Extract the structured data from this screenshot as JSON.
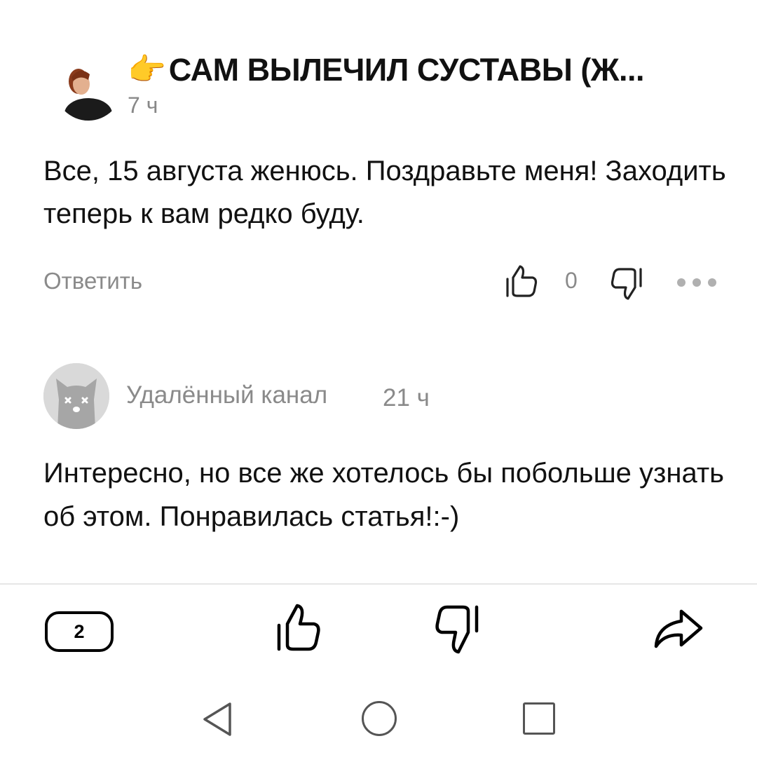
{
  "comments": [
    {
      "author": "САМ ВЫЛЕЧИЛ СУСТАВЫ (Ж...",
      "author_emoji": "👉",
      "time": "7 ч",
      "text": "Все, 15 августа женюсь. Поздравьте меня! Заходить теперь к вам редко буду.",
      "reply_label": "Ответить",
      "likes": "0"
    },
    {
      "author": "Удалённый канал",
      "time": "21 ч",
      "text": "Интересно, но все же хотелось бы побольше узнать об этом. Понравилась статья!:-)"
    }
  ],
  "bottom_bar": {
    "comments_count": "2"
  },
  "icons": {
    "like": "thumbs-up-icon",
    "dislike": "thumbs-down-icon",
    "more": "more-dots-icon",
    "share": "share-icon",
    "back": "nav-back-icon",
    "home": "nav-home-icon",
    "recent": "nav-recent-icon"
  }
}
